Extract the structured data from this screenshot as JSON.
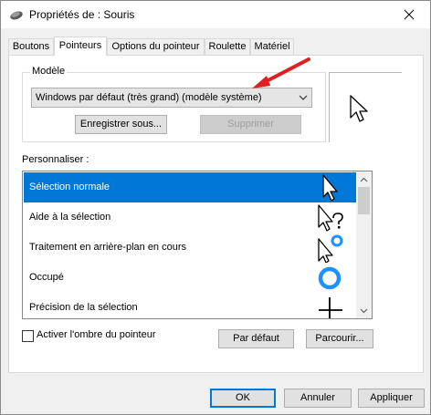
{
  "window": {
    "title": "Propriétés de : Souris"
  },
  "tabs": [
    {
      "label": "Boutons"
    },
    {
      "label": "Pointeurs"
    },
    {
      "label": "Options du pointeur"
    },
    {
      "label": "Roulette"
    },
    {
      "label": "Matériel"
    }
  ],
  "scheme": {
    "group_label": "Modèle",
    "selected": "Windows par défaut (très grand) (modèle système)",
    "save_as_label": "Enregistrer sous...",
    "delete_label": "Supprimer"
  },
  "customize": {
    "label": "Personnaliser :",
    "items": [
      {
        "label": "Sélection normale",
        "cursor_icon": "arrow-icon"
      },
      {
        "label": "Aide à la sélection",
        "cursor_icon": "help-select-icon"
      },
      {
        "label": "Traitement en arrière-plan en cours",
        "cursor_icon": "working-in-background-icon"
      },
      {
        "label": "Occupé",
        "cursor_icon": "busy-icon"
      },
      {
        "label": "Précision de la sélection",
        "cursor_icon": "precision-crosshair-icon"
      }
    ],
    "selected_index": 0
  },
  "shadow": {
    "label": "Activer l'ombre du pointeur",
    "checked": false
  },
  "buttons": {
    "default_label": "Par défaut",
    "browse_label": "Parcourir...",
    "ok_label": "OK",
    "cancel_label": "Annuler",
    "apply_label": "Appliquer"
  },
  "colors": {
    "accent": "#0078d7",
    "annotation_arrow": "#e02020",
    "busy_ring": "#1e90ff"
  }
}
